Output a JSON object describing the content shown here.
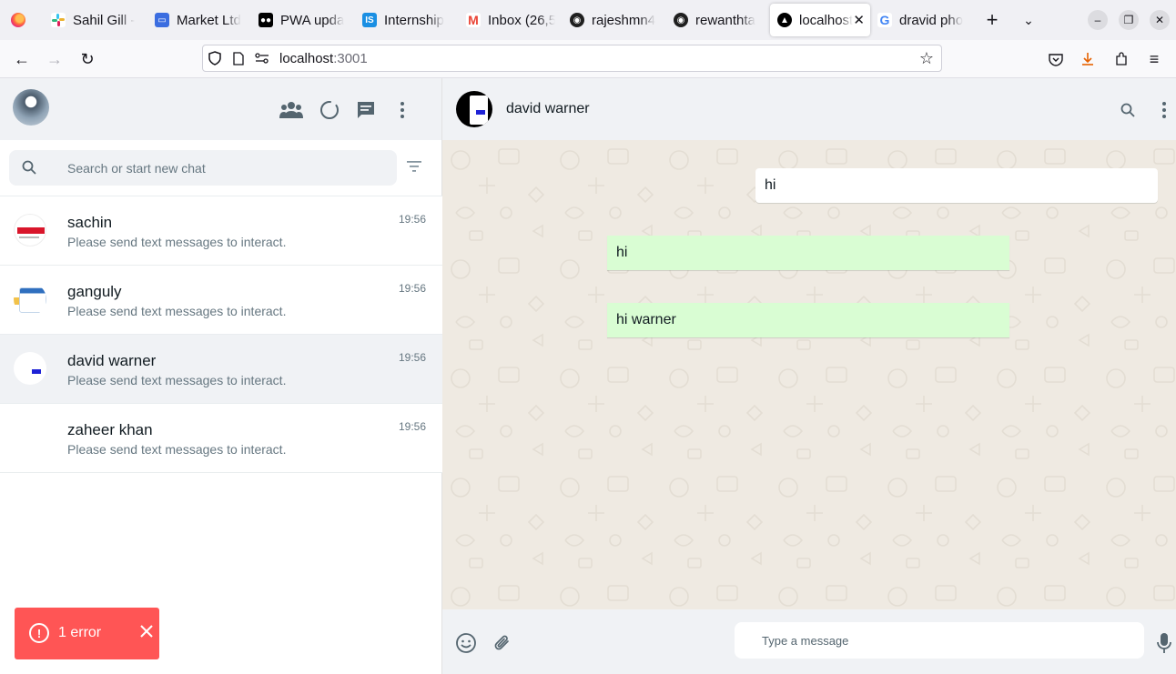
{
  "browser": {
    "tabs": [
      {
        "title": "Sahil Gill -",
        "favicon": "slack-icon",
        "color": "#e01e5a"
      },
      {
        "title": "Market Ltd",
        "favicon": "chat-icon",
        "color": "#3b6de0"
      },
      {
        "title": "PWA upda",
        "favicon": "medium-icon",
        "color": "#000000"
      },
      {
        "title": "Internship",
        "favicon": "internshala-icon",
        "color": "#1a8fe3"
      },
      {
        "title": "Inbox (26,5",
        "favicon": "gmail-icon",
        "color": "#ea4335"
      },
      {
        "title": "rajeshmn4",
        "favicon": "github-icon",
        "color": "#1f1f1f"
      },
      {
        "title": "rewanthta",
        "favicon": "github-icon",
        "color": "#1f1f1f"
      },
      {
        "title": "localhost",
        "favicon": "nextjs-icon",
        "color": "#000000",
        "active": true
      },
      {
        "title": "dravid pho",
        "favicon": "google-icon",
        "color": "#4285f4"
      }
    ],
    "url_host": "localhost",
    "url_port": ":3001"
  },
  "sidebar": {
    "search_placeholder": "Search or start new chat",
    "chats": [
      {
        "name": "sachin",
        "last_message": "Please send text messages to interact.",
        "time": "19:56",
        "avatar": "sachin"
      },
      {
        "name": "ganguly",
        "last_message": "Please send text messages to interact.",
        "time": "19:56",
        "avatar": "ganguly"
      },
      {
        "name": "david warner",
        "last_message": "Please send text messages to interact.",
        "time": "19:56",
        "avatar": "david",
        "active": true
      },
      {
        "name": "zaheer khan",
        "last_message": "Please send text messages to interact.",
        "time": "19:56",
        "avatar": "zaheer"
      }
    ]
  },
  "conversation": {
    "contact_name": "david warner",
    "messages": [
      {
        "text": "hi",
        "direction": "incoming"
      },
      {
        "text": "hi",
        "direction": "outgoing"
      },
      {
        "text": "hi warner",
        "direction": "outgoing"
      }
    ],
    "composer_placeholder": "Type a message"
  },
  "error_toast": {
    "label": "1 error"
  },
  "colors": {
    "accent_header": "#f0f2f5",
    "outgoing_bubble": "#d9fdd3",
    "chat_background": "#efeae2",
    "error": "#ff5555"
  }
}
